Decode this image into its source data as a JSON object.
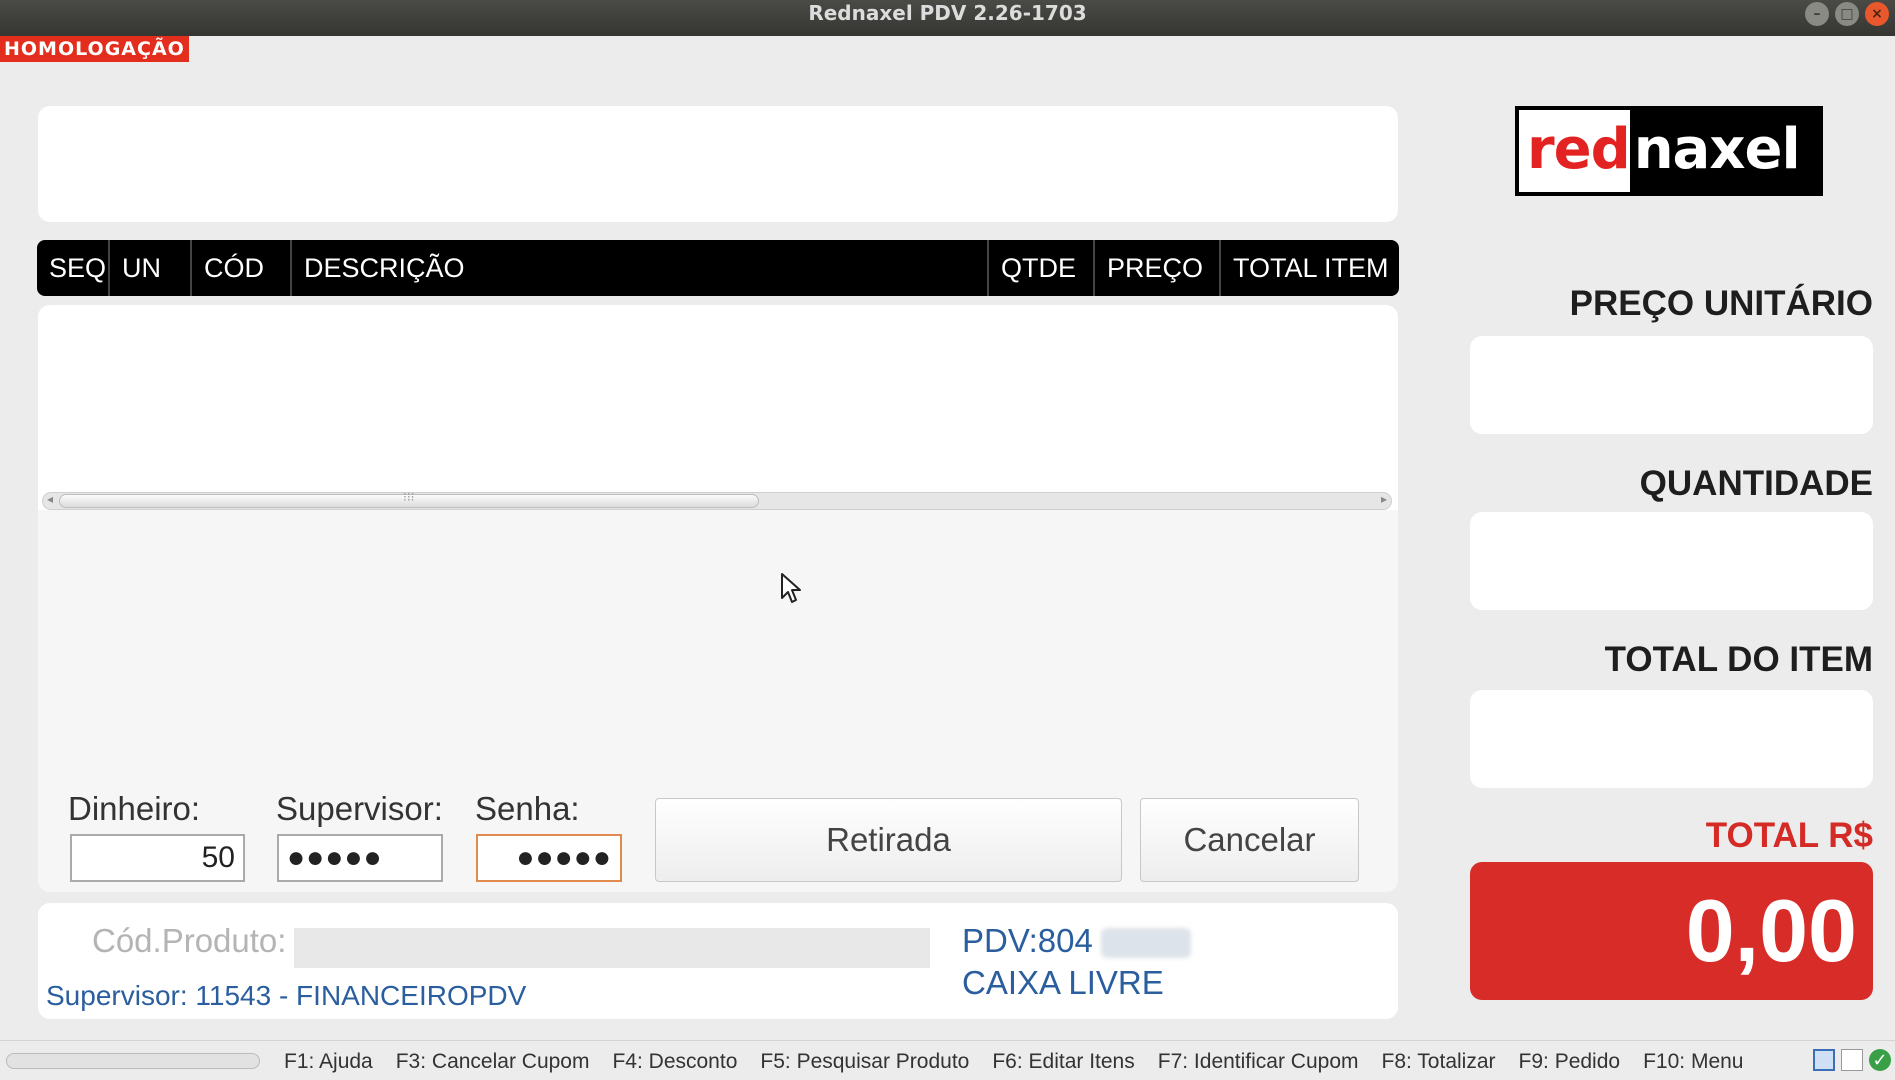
{
  "window": {
    "title": "Rednaxel PDV 2.26-1703",
    "controls": [
      "minimize",
      "maximize",
      "close"
    ]
  },
  "env_badge": "HOMOLOGAÇÃO",
  "grid": {
    "columns": [
      "SEQ",
      "UN",
      "CÓD",
      "DESCRIÇÃO",
      "QTDE",
      "PREÇO",
      "TOTAL ITEM"
    ],
    "rows": []
  },
  "withdrawal": {
    "dinheiro_label": "Dinheiro:",
    "dinheiro_value": "50",
    "supervisor_label": "Supervisor:",
    "supervisor_value": "●●●●●",
    "senha_label": "Senha:",
    "senha_value": "●●●●●",
    "retirada_button": "Retirada",
    "cancelar_button": "Cancelar"
  },
  "info": {
    "cod_produto_label": "Cód.Produto:",
    "cod_produto_value": "",
    "supervisor": "Supervisor: 11543 - FINANCEIROPDV",
    "pdv": "PDV:804",
    "status": "CAIXA LIVRE"
  },
  "logo": {
    "part1": "red",
    "part2": "naxel"
  },
  "right": {
    "preco_unitario_label": "PREÇO UNITÁRIO",
    "preco_unitario_value": "",
    "quantidade_label": "QUANTIDADE",
    "quantidade_value": "",
    "total_item_label": "TOTAL DO ITEM",
    "total_item_value": "",
    "total_label": "TOTAL R$",
    "total_value": "0,00"
  },
  "shortcuts": [
    "F1: Ajuda",
    "F3: Cancelar Cupom",
    "F4: Desconto",
    "F5: Pesquisar Produto",
    "F6: Editar Itens",
    "F7: Identificar Cupom",
    "F8: Totalizar",
    "F9: Pedido",
    "F10: Menu"
  ],
  "colors": {
    "accent_red": "#d72c28",
    "info_blue": "#2a5e9e",
    "badge_red": "#e32e1e"
  }
}
